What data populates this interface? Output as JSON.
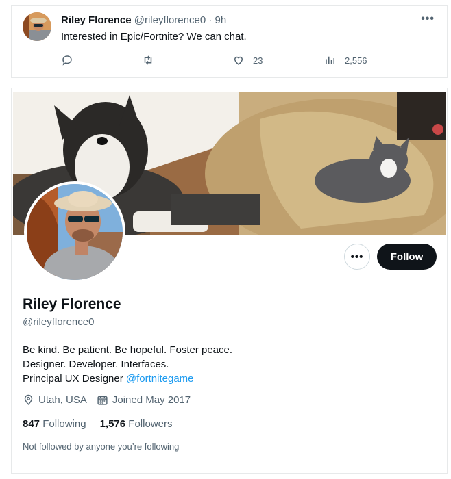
{
  "tweet": {
    "name": "Riley Florence",
    "handle": "@rileyflorence0",
    "separator": "·",
    "time": "9h",
    "text": "Interested in Epic/Fortnite? We can chat.",
    "more": "•••",
    "likes": "23",
    "views": "2,556",
    "icons": [
      "reply-icon",
      "retweet-icon",
      "heart-icon",
      "views-icon"
    ]
  },
  "profile": {
    "name": "Riley Florence",
    "handle": "@rileyflorence0",
    "bio_line1": "Be kind. Be patient. Be hopeful. Foster peace.",
    "bio_line2": "Designer. Developer. Interfaces.",
    "bio_line3_prefix": "Principal UX Designer ",
    "bio_mention": "@fortnitegame",
    "location": "Utah, USA",
    "joined": "Joined May 2017",
    "following_count": "847",
    "following_label": "Following",
    "followers_count": "1,576",
    "followers_label": "Followers",
    "not_followed": "Not followed by anyone you’re following",
    "more_label": "•••",
    "follow_label": "Follow"
  },
  "colors": {
    "text": "#0f1419",
    "secondary": "#536471",
    "link": "#1d9bf0",
    "follow_bg": "#0f1419",
    "border": "#e7e9ea"
  }
}
